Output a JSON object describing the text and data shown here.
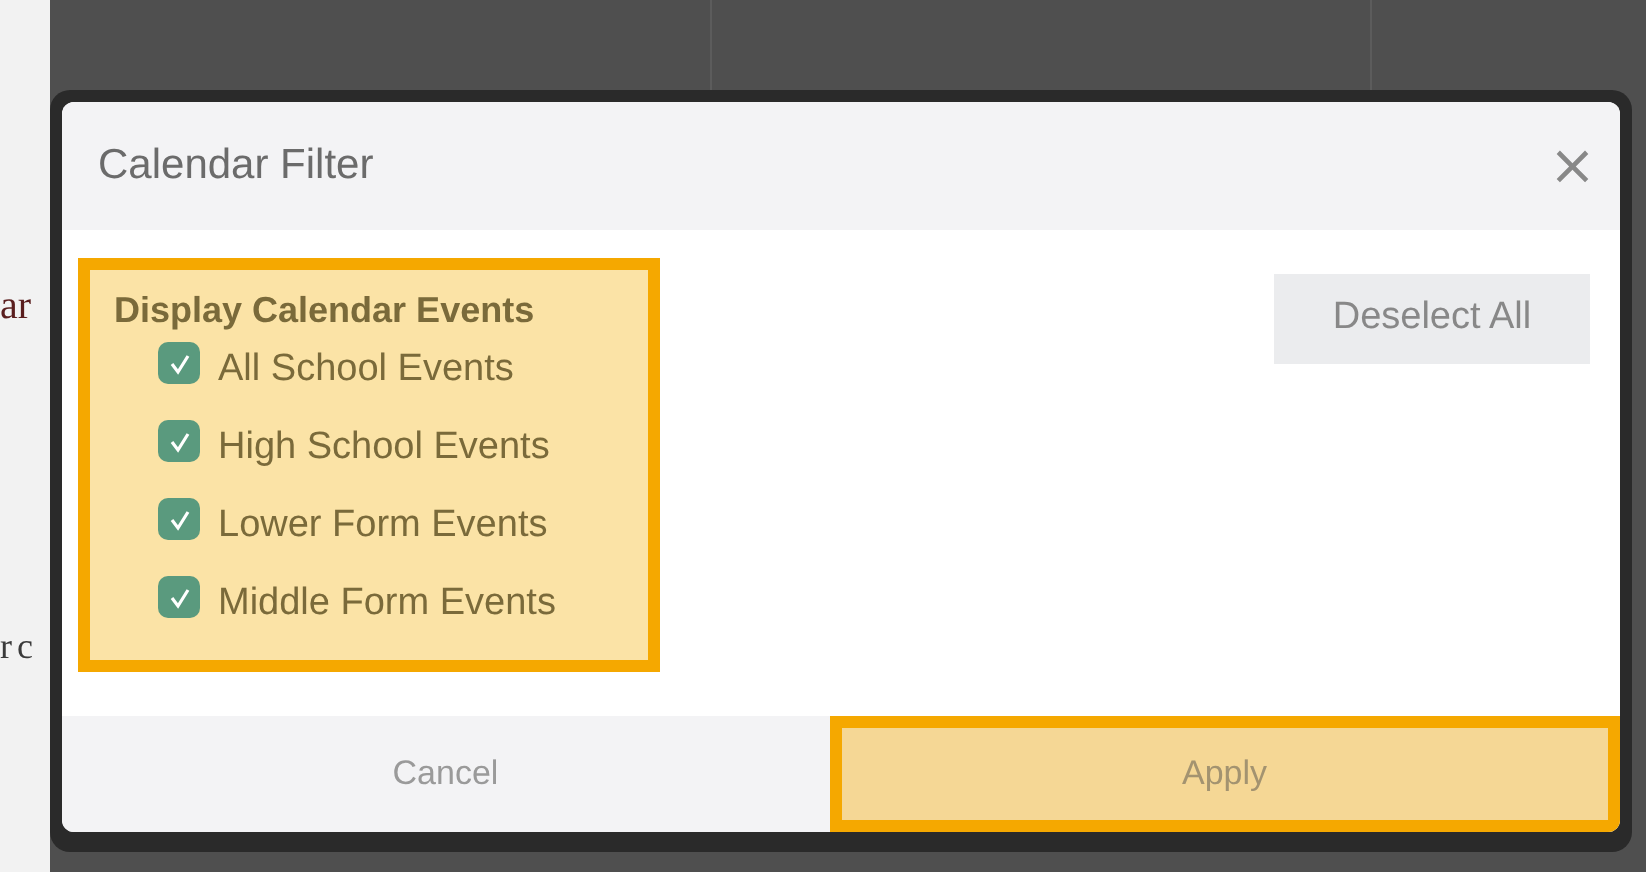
{
  "background_text": [
    "ar",
    "r c"
  ],
  "dialog": {
    "title": "Calendar Filter",
    "close": "×",
    "group": {
      "heading": "Display Calendar Events",
      "highlighted": true,
      "options": [
        {
          "label": "All School Events",
          "checked": true
        },
        {
          "label": "High School Events",
          "checked": true
        },
        {
          "label": "Lower Form Events",
          "checked": true
        },
        {
          "label": "Middle Form Events",
          "checked": true
        }
      ]
    },
    "deselect_button": "Deselect All",
    "footer": [
      {
        "label": "Cancel",
        "highlighted": false
      },
      {
        "label": "Apply",
        "highlighted": true
      }
    ]
  }
}
